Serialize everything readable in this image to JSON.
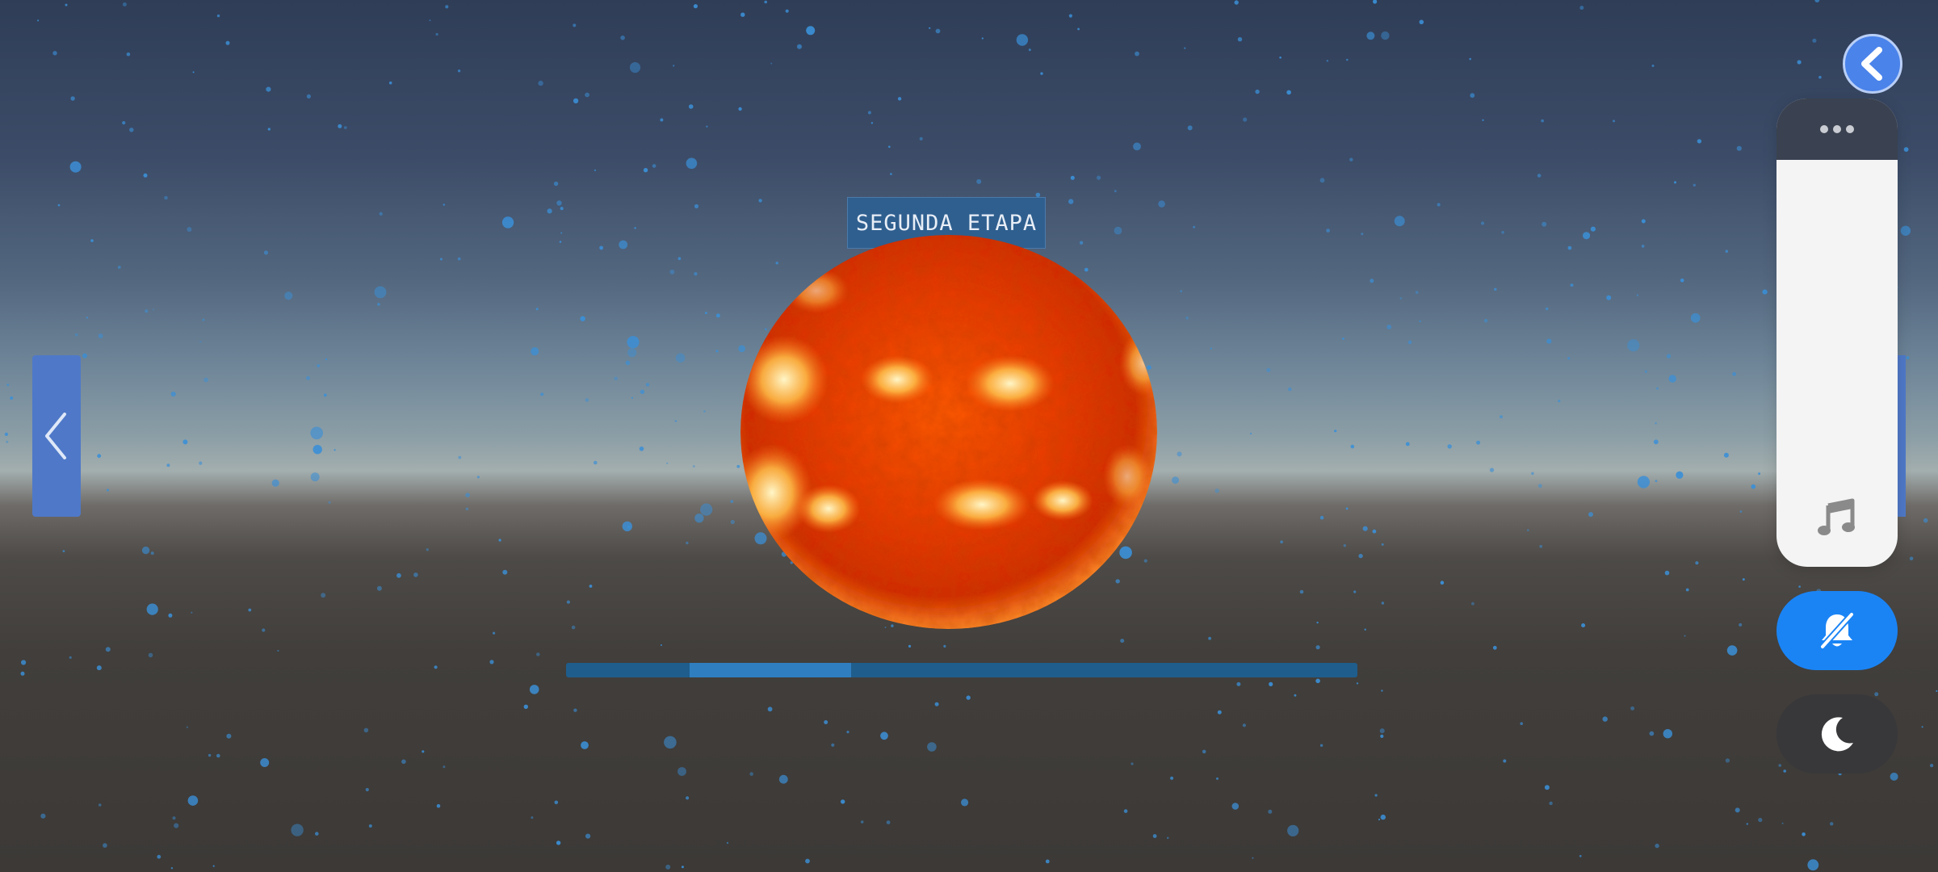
{
  "stage": {
    "label": "SEGUNDA ETAPA"
  },
  "progress": {
    "fraction_start": 0.156,
    "fraction_end": 0.36
  },
  "icons": {
    "prev": "chevron-left-icon",
    "back": "chevron-left-icon",
    "menu": "more-dots-icon",
    "music": "music-note-icon",
    "mute": "bell-off-icon",
    "night": "moon-icon"
  },
  "colors": {
    "accent": "#1a84f5",
    "stage_label_bg": "#2f5f8f",
    "progress_track": "#1f5d8c",
    "progress_fill": "#2f7fc0",
    "nav_arrow": "#4f79c8"
  }
}
